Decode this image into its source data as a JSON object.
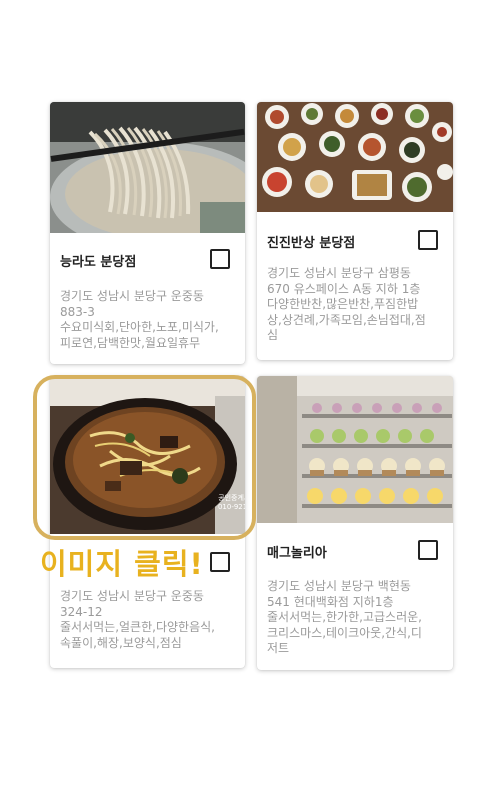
{
  "cards": [
    {
      "name": "능라도 분당점",
      "address": "경기도 성남시 분당구 운중동\n883-3\n수요미식회,단아한,노포,미식가,\n피로연,담백한맛,월요일휴무",
      "photo_subject": "noodle-dish"
    },
    {
      "name": "진진반상 분당점",
      "address": "경기도 성남시 분당구 삼평동\n670 유스페이스 A동 지하 1층\n다양한반찬,많은반찬,푸짐한밥\n상,상견례,가족모임,손님접대,점\n심",
      "photo_subject": "korean-banchan-table"
    },
    {
      "name": "",
      "address": "경기도 성남시 분당구 운중동\n324-12\n줄서서먹는,얼큰한,다양한음식,\n속풀이,해장,보양식,점심",
      "photo_subject": "hangover-soup",
      "photo_watermark": "공인중계사 허현미\n010-9218-9666"
    },
    {
      "name": "매그놀리아",
      "address": "경기도 성남시 분당구 백현동\n541 현대백화점 지하1층\n줄서서먹는,한가한,고급스러운,\n크리스마스,테이크아웃,간식,디\n저트",
      "photo_subject": "cupcakes-display"
    }
  ],
  "callout": {
    "text": "이미지 클릭!",
    "color": "#e8b21f",
    "highlight_color": "#d7b15e"
  },
  "icons": {
    "checkbox": "checkbox-icon"
  }
}
